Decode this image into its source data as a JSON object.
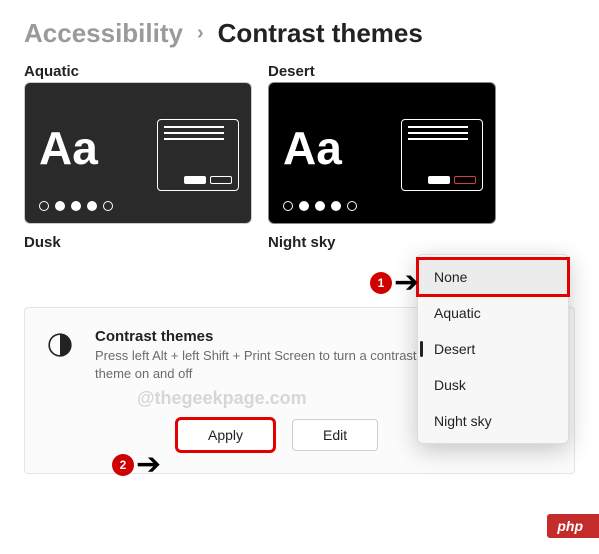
{
  "breadcrumb": {
    "parent": "Accessibility",
    "current": "Contrast themes"
  },
  "previews": {
    "top_left_label": "Aquatic",
    "top_right_label": "Desert",
    "bottom_left_label": "Dusk",
    "bottom_right_label": "Night sky",
    "sample_text": "Aa"
  },
  "card": {
    "title": "Contrast themes",
    "desc": "Press left Alt + left Shift + Print Screen to turn a contrast theme on and off",
    "apply_label": "Apply",
    "edit_label": "Edit"
  },
  "dropdown": {
    "items": [
      "None",
      "Aquatic",
      "Desert",
      "Dusk",
      "Night sky"
    ],
    "selected": "Desert",
    "hovered": "None"
  },
  "annotations": {
    "num1": "1",
    "num2": "2"
  },
  "watermark": "@thegeekpage.com",
  "footer_badge": "php"
}
